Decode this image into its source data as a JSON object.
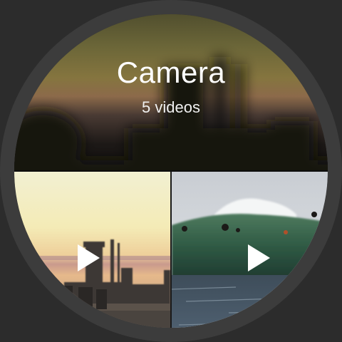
{
  "album": {
    "title": "Camera",
    "subtitle": "5 videos"
  },
  "videos": [
    {
      "thumbnail": "sunset-harbor-thumbnail",
      "icon": "play-icon"
    },
    {
      "thumbnail": "surf-wave-thumbnail",
      "icon": "play-icon"
    }
  ],
  "colors": {
    "bezel": "#3c3c3c",
    "background": "#2c2c2c",
    "text": "#ffffff"
  }
}
